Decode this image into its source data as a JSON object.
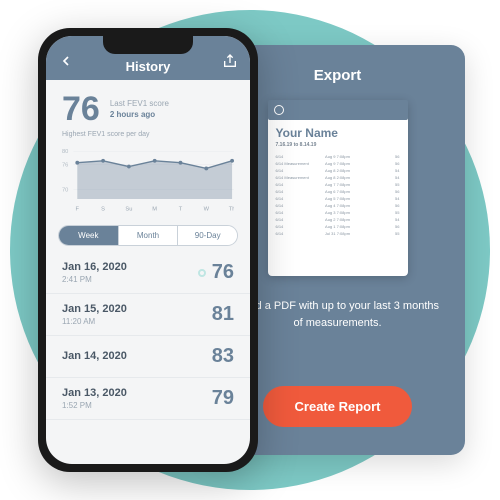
{
  "header": {
    "title": "History"
  },
  "score": {
    "value": "76",
    "label": "Last FEV1 score",
    "ago": "2 hours ago"
  },
  "chart_caption": "Highest FEV1 score per day",
  "chart_data": {
    "type": "area",
    "categories": [
      "F",
      "S",
      "Su",
      "M",
      "T",
      "W",
      "Th"
    ],
    "values": [
      75,
      76,
      74,
      76,
      75,
      73,
      76
    ],
    "ylabel": "",
    "xlabel": "",
    "ylim": [
      0,
      100
    ],
    "y_ticks": [
      70,
      76,
      80
    ]
  },
  "tabs": [
    {
      "label": "Week",
      "active": true
    },
    {
      "label": "Month",
      "active": false
    },
    {
      "label": "90-Day",
      "active": false
    }
  ],
  "rows": [
    {
      "date": "Jan 16, 2020",
      "time": "2:41 PM",
      "value": "76",
      "dot": true
    },
    {
      "date": "Jan 15, 2020",
      "time": "11:20 AM",
      "value": "81",
      "dot": false
    },
    {
      "date": "Jan 14, 2020",
      "time": "",
      "value": "83",
      "dot": false
    },
    {
      "date": "Jan 13, 2020",
      "time": "1:52 PM",
      "value": "79",
      "dot": false
    }
  ],
  "export": {
    "title": "Export",
    "pdf": {
      "name": "Your Name",
      "range": "7.16.19 to 8.14.19",
      "rows": [
        [
          "6/14",
          "Aug 9  7:08pm",
          "56"
        ],
        [
          "6/14  Measurement",
          "Aug 9  7:08pm",
          "56"
        ],
        [
          "6/14",
          "Aug 8  2:08pm",
          "54"
        ],
        [
          "6/14  Measurement",
          "Aug 8  2:08pm",
          "54"
        ],
        [
          "6/14",
          "Aug 7  7:08pm",
          "55"
        ],
        [
          "6/14",
          "Aug 6  7:08pm",
          "56"
        ],
        [
          "6/14",
          "Aug 5  7:08pm",
          "54"
        ],
        [
          "6/14",
          "Aug 4  7:08pm",
          "56"
        ],
        [
          "6/14",
          "Aug 3  7:08pm",
          "55"
        ],
        [
          "6/14",
          "Aug 2  7:08pm",
          "54"
        ],
        [
          "6/14",
          "Aug 1  7:08pm",
          "56"
        ],
        [
          "6/14",
          "Jul 31 7:08pm",
          "55"
        ]
      ]
    },
    "desc": "Send a PDF with up to your last 3 months of measurements.",
    "button": "Create Report"
  }
}
